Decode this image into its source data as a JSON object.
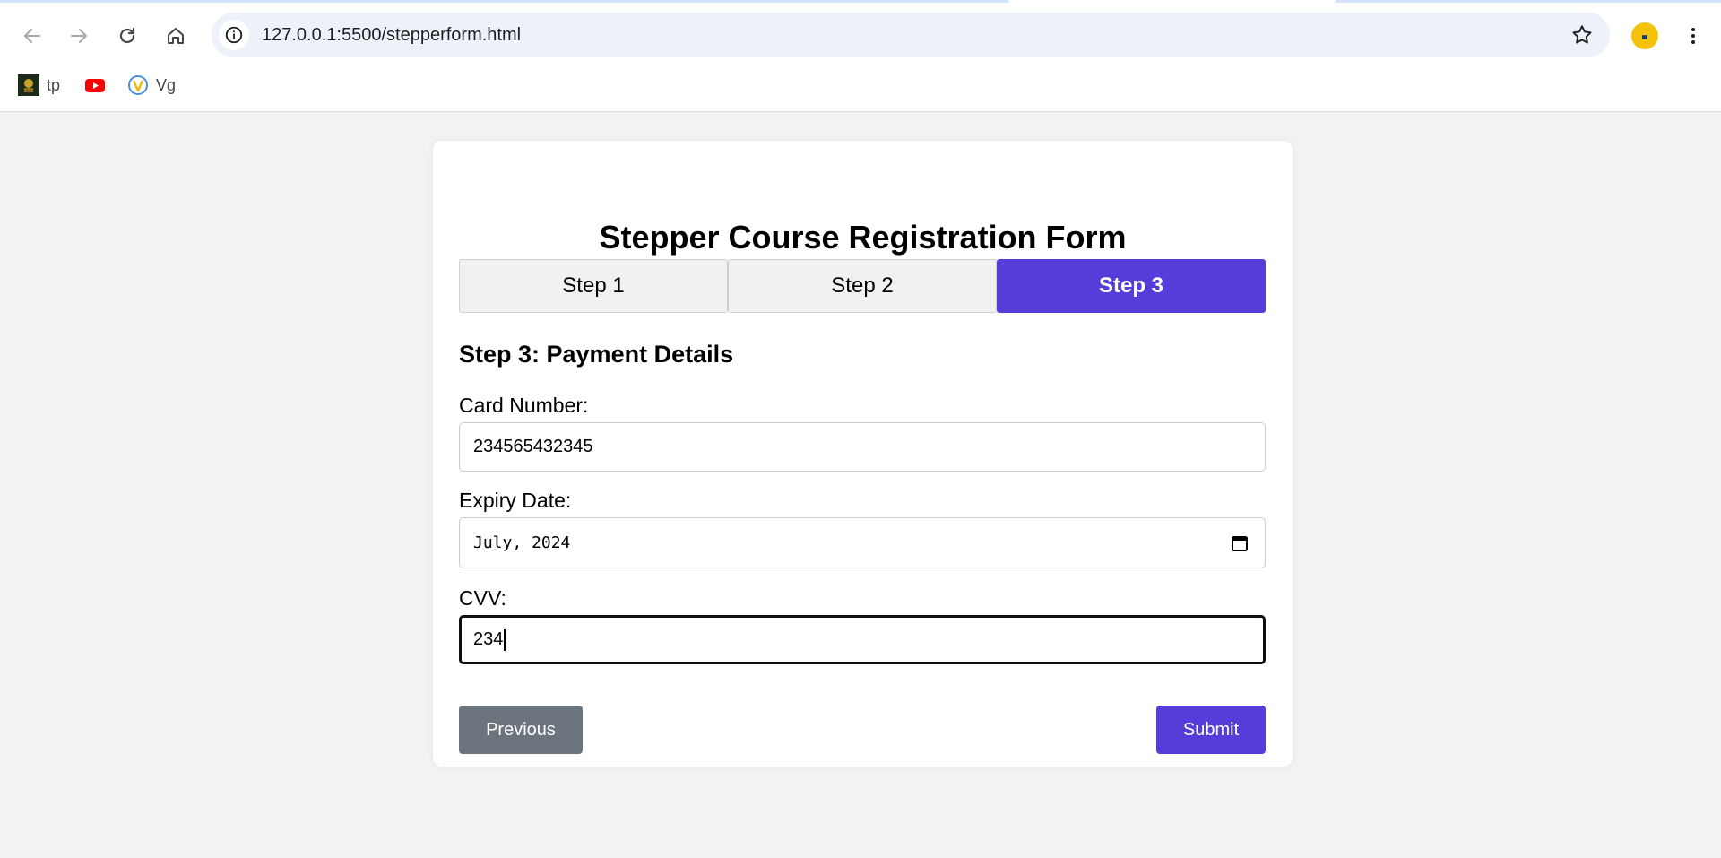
{
  "browser": {
    "url": "127.0.0.1:5500/stepperform.html",
    "bookmarks": [
      {
        "label": "tp",
        "icon": "tp-favicon-icon"
      },
      {
        "label": "",
        "icon": "youtube-icon"
      },
      {
        "label": "Vg",
        "icon": "vg-favicon-icon"
      }
    ],
    "colors": {
      "omnibox_bg": "#edf1fa",
      "profile": "#f4c20d"
    }
  },
  "form": {
    "title": "Stepper Course Registration Form",
    "steps": [
      {
        "label": "Step 1",
        "active": false
      },
      {
        "label": "Step 2",
        "active": false
      },
      {
        "label": "Step 3",
        "active": true
      }
    ],
    "section_heading": "Step 3: Payment Details",
    "fields": {
      "card_number": {
        "label": "Card Number:",
        "value": "234565432345"
      },
      "expiry": {
        "label": "Expiry Date:",
        "value": "July, 2024"
      },
      "cvv": {
        "label": "CVV:",
        "value": "234"
      }
    },
    "buttons": {
      "previous": "Previous",
      "submit": "Submit"
    },
    "colors": {
      "accent": "#553dd9",
      "secondary": "#6c757d",
      "page_bg": "#f2f2f2"
    }
  }
}
